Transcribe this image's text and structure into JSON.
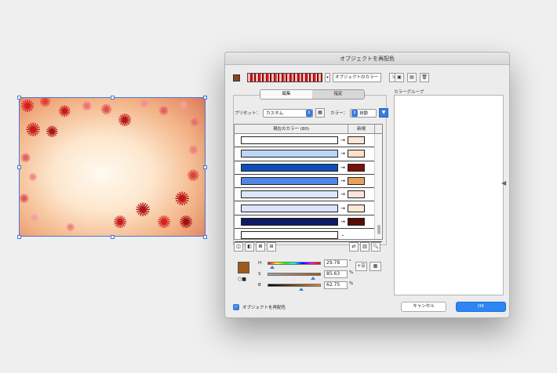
{
  "dialog": {
    "title": "オブジェクトを再配色",
    "harmony_combo": "オブジェクトのカラー",
    "tabs": [
      {
        "label": "編集",
        "active": false
      },
      {
        "label": "指定",
        "active": true
      }
    ],
    "preset_label": "プリセット：",
    "preset_value": "カスタム",
    "color_label": "カラー：",
    "color_value": "自動",
    "table_headers": {
      "current": "現在のカラー (80)",
      "new": "新規"
    },
    "rows": [
      {
        "current": "#ffffff",
        "arrow": "→",
        "new": "#fbe6d8"
      },
      {
        "current": "#bcd6f7",
        "arrow": "→",
        "new": "#fde0c8"
      },
      {
        "current": "#0e4eb8",
        "arrow": "→",
        "new": "#7a0f0b"
      },
      {
        "current": "#4f87e4",
        "arrow": "→",
        "new": "#e6a25a"
      },
      {
        "current": "#dbe8fb",
        "arrow": "→",
        "new": "#fde2e0"
      },
      {
        "current": "#dde2ff",
        "arrow": "→",
        "new": "#fce7d3"
      },
      {
        "current": "#0d1a64",
        "arrow": "→",
        "new": "#5a0a06"
      },
      {
        "current": "#ffffff",
        "arrow": "–",
        "new": ""
      }
    ],
    "sliders": {
      "h": {
        "label": "H",
        "value": "29.78",
        "unit": "°",
        "fraction": 0.08
      },
      "s": {
        "label": "S",
        "value": "85.63",
        "unit": "%",
        "fraction": 0.86
      },
      "b": {
        "label": "B",
        "value": "62.75",
        "unit": "%",
        "fraction": 0.63
      }
    },
    "color_group_label": "カラーグループ",
    "recolor_checkbox": {
      "label": "オブジェクトを再配色",
      "checked": true
    },
    "cancel_label": "キャンセル",
    "ok_label": "OK"
  },
  "colors": {
    "accent": "#2e86f5",
    "selected_swatch": "#9e5a1a"
  }
}
